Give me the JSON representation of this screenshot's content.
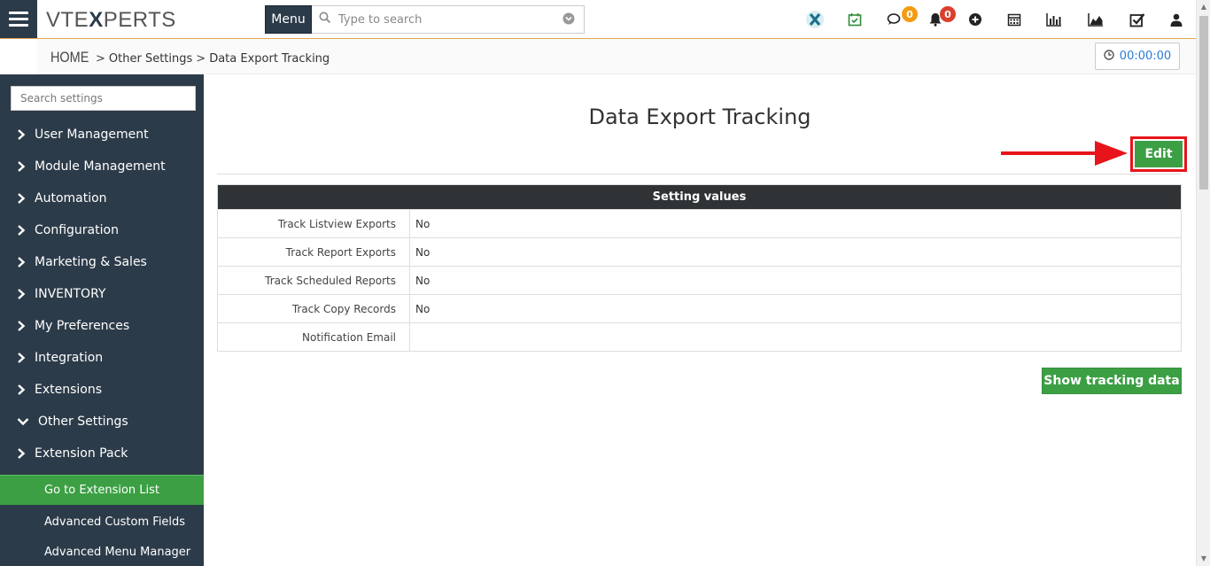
{
  "topbar": {
    "logo_text": "VTEXPERTS",
    "menu_label": "Menu",
    "search_placeholder": "Type to search",
    "badges": {
      "comments": "0",
      "notifications": "0"
    },
    "icons": [
      "vtex-x-icon",
      "calendar-check-icon",
      "comments-icon",
      "bell-icon",
      "plus-circle-icon",
      "calendar-icon",
      "bar-chart-icon",
      "area-chart-icon",
      "checkbox-icon",
      "user-icon"
    ],
    "colors": {
      "badge_orange": "#f39c12",
      "badge_red": "#d9412c",
      "accent_green": "#3c9f44",
      "sidebar_bg": "#2c3b49"
    }
  },
  "breadcrumb": {
    "home": "HOME",
    "level1": "Other Settings",
    "level2": "Data Export Tracking",
    "sep": ">"
  },
  "timer": {
    "value": "00:00:00"
  },
  "sidebar": {
    "search_placeholder": "Search settings",
    "items": [
      {
        "label": "User Management",
        "expanded": false
      },
      {
        "label": "Module Management",
        "expanded": false
      },
      {
        "label": "Automation",
        "expanded": false
      },
      {
        "label": "Configuration",
        "expanded": false
      },
      {
        "label": "Marketing & Sales",
        "expanded": false
      },
      {
        "label": "INVENTORY",
        "expanded": false
      },
      {
        "label": "My Preferences",
        "expanded": false
      },
      {
        "label": "Integration",
        "expanded": false
      },
      {
        "label": "Extensions",
        "expanded": false
      },
      {
        "label": "Other Settings",
        "expanded": true
      },
      {
        "label": "Extension Pack",
        "expanded": false
      }
    ],
    "sub_items": [
      {
        "label": "Go to Extension List",
        "active": true
      },
      {
        "label": "Advanced Custom Fields",
        "active": false
      },
      {
        "label": "Advanced Menu Manager",
        "active": false
      }
    ]
  },
  "main": {
    "title": "Data Export Tracking",
    "edit_label": "Edit",
    "table_header": "Setting values",
    "rows": [
      {
        "label": "Track Listview Exports",
        "value": "No"
      },
      {
        "label": "Track Report Exports",
        "value": "No"
      },
      {
        "label": "Track Scheduled Reports",
        "value": "No"
      },
      {
        "label": "Track Copy Records",
        "value": "No"
      },
      {
        "label": "Notification Email",
        "value": ""
      }
    ],
    "show_tracking_label": "Show tracking data"
  }
}
